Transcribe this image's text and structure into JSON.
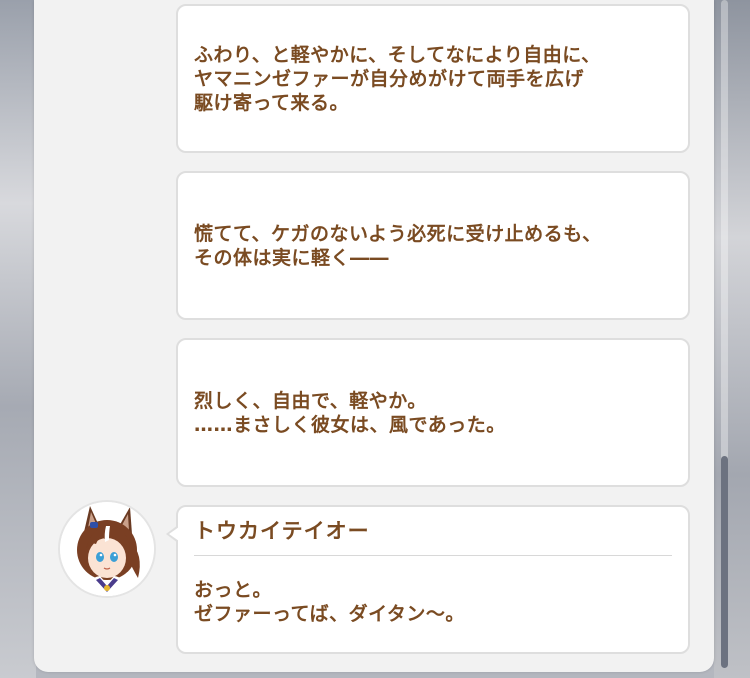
{
  "log": {
    "narrations": [
      {
        "text": "ふわり、と軽やかに、そしてなにより自由に、\nヤマニンゼファーが自分めがけて両手を広げ\n駆け寄って来る。"
      },
      {
        "text": "慌てて、ケガのないよう必死に受け止めるも、\nその体は実に軽く――"
      },
      {
        "text": "烈しく、自由で、軽やか。\n……まさしく彼女は、風であった。"
      }
    ],
    "dialogue": {
      "speaker": "トウカイテイオー",
      "text": "おっと。\nゼファーってば、ダイタン～。",
      "avatar": "character-portrait"
    }
  },
  "colors": {
    "text": "#7a4b22",
    "bubble_bg": "#ffffff",
    "bubble_border": "#dedede",
    "panel_bg": "#f2f2f2",
    "scrollbar": "#6c7280"
  }
}
